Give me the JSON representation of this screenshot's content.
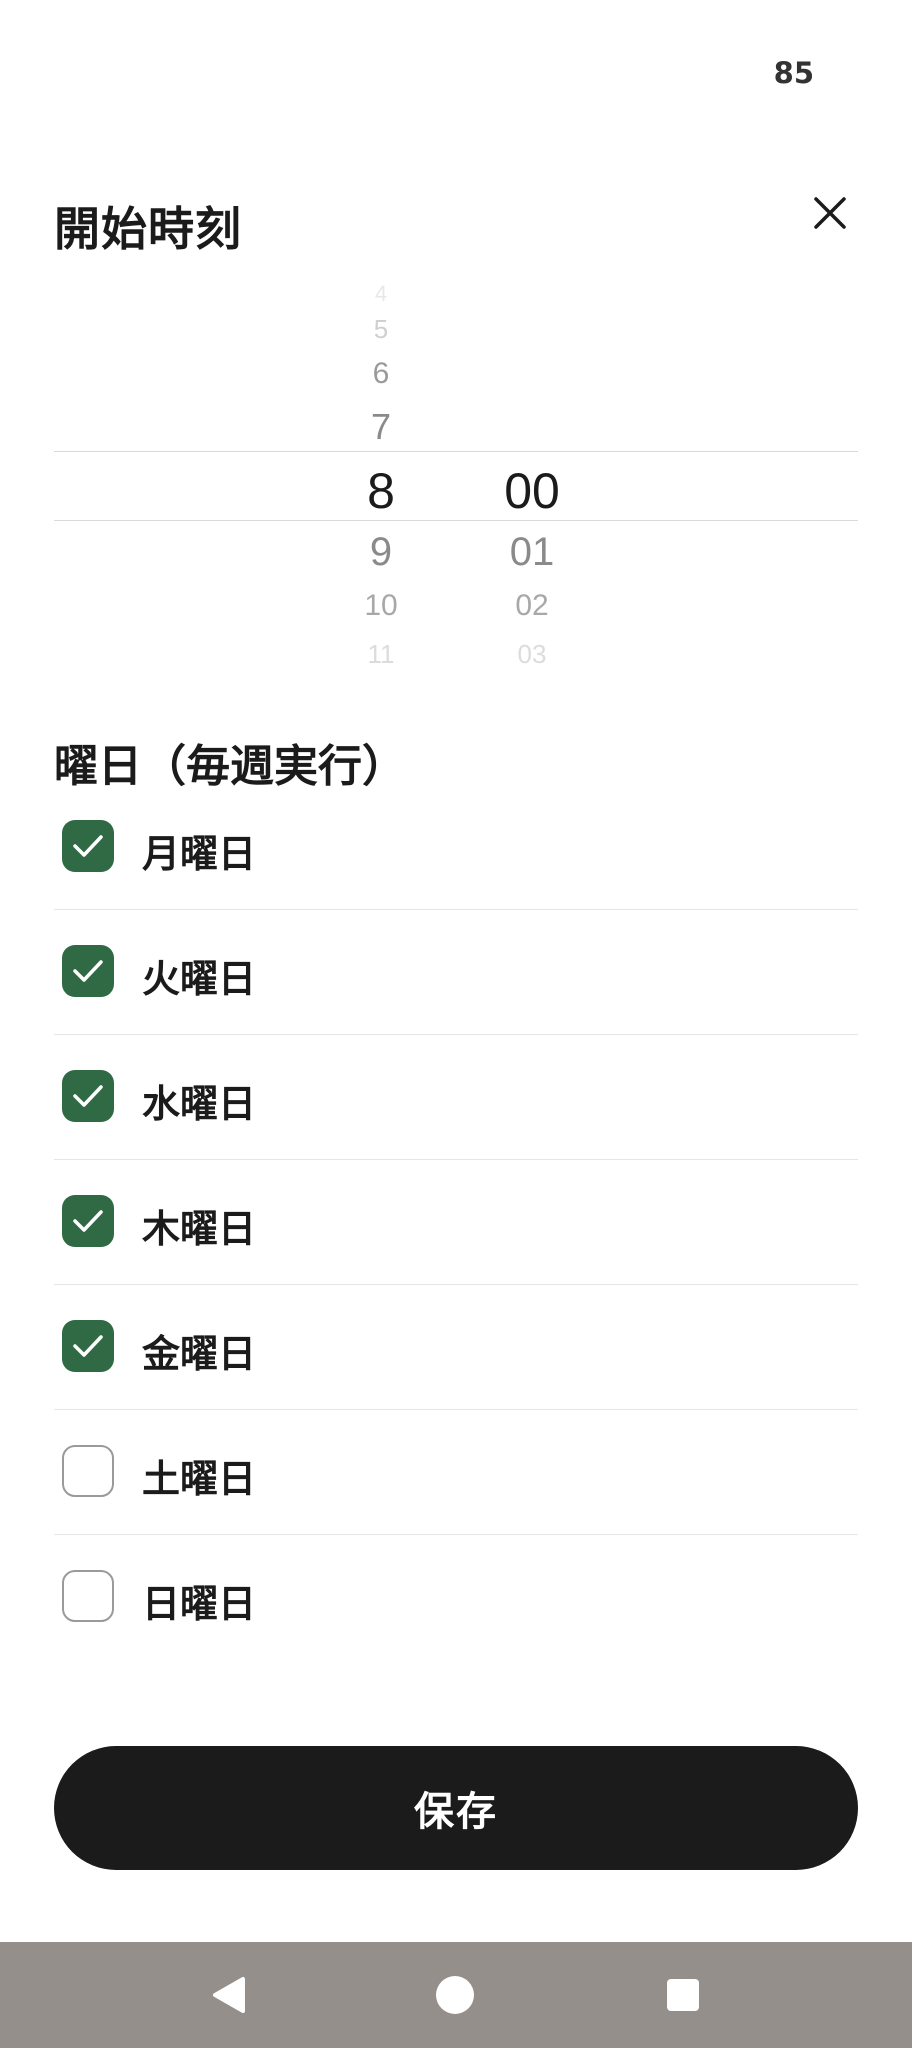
{
  "status_bar": {
    "battery": "85"
  },
  "header": {
    "title": "開始時刻",
    "close_icon": "close-icon"
  },
  "time_picker": {
    "hours": [
      "4",
      "5",
      "6",
      "7",
      "8",
      "9",
      "10",
      "11"
    ],
    "minutes": [
      "00",
      "01",
      "02",
      "03"
    ],
    "selected_hour": "8",
    "selected_minute": "00"
  },
  "days": {
    "title": "曜日（毎週実行）",
    "items": [
      {
        "label": "月曜日",
        "checked": true
      },
      {
        "label": "火曜日",
        "checked": true
      },
      {
        "label": "水曜日",
        "checked": true
      },
      {
        "label": "木曜日",
        "checked": true
      },
      {
        "label": "金曜日",
        "checked": true
      },
      {
        "label": "土曜日",
        "checked": false
      },
      {
        "label": "日曜日",
        "checked": false
      }
    ]
  },
  "save_button": {
    "label": "保存"
  },
  "nav_bar": {
    "back_icon": "back-triangle-icon",
    "home_icon": "home-circle-icon",
    "recents_icon": "recents-square-icon"
  },
  "colors": {
    "accent": "#2f6a45",
    "button_bg": "#1b1b1b",
    "nav_bg": "#958f8c"
  }
}
